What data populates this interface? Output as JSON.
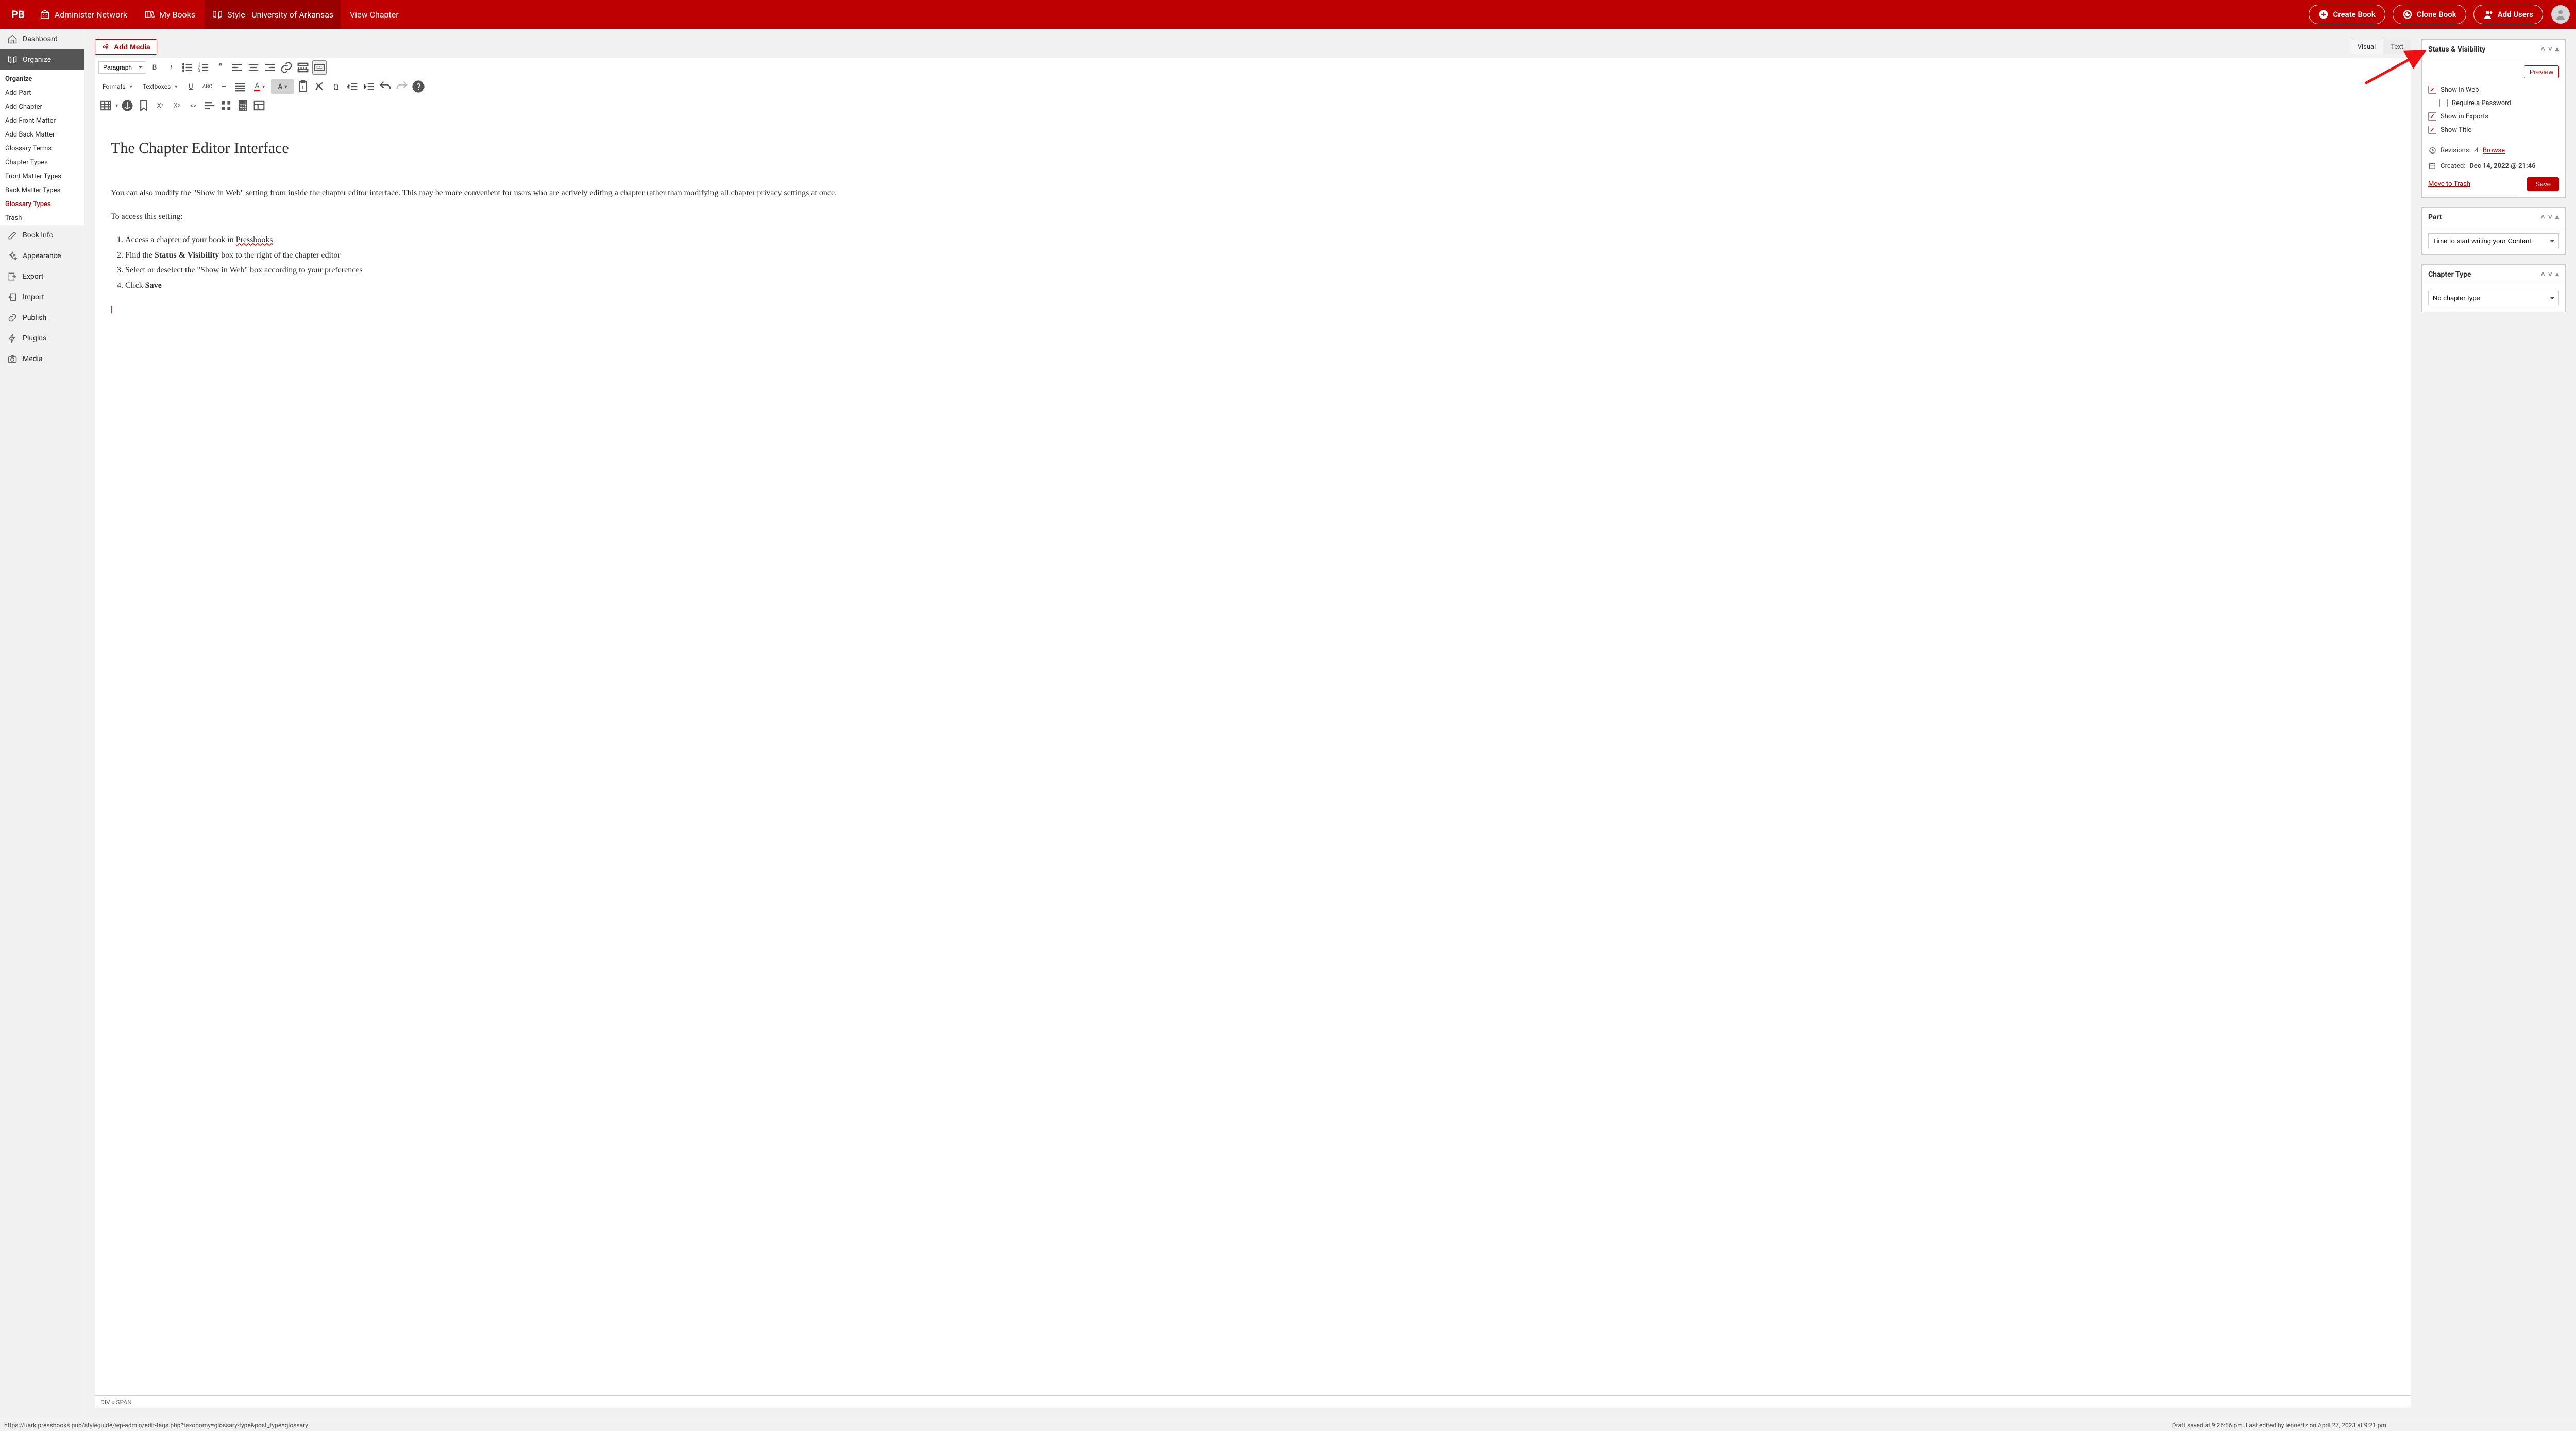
{
  "topbar": {
    "logo": "PB",
    "items": [
      {
        "label": "Administer Network",
        "icon": "building-icon"
      },
      {
        "label": "My Books",
        "icon": "books-icon"
      },
      {
        "label": "Style - University of Arkansas",
        "icon": "book-open-icon",
        "active": true
      },
      {
        "label": "View Chapter"
      }
    ],
    "buttons": [
      {
        "label": "Create Book",
        "icon": "plus-circle-icon"
      },
      {
        "label": "Clone Book",
        "icon": "clone-circle-icon"
      },
      {
        "label": "Add Users",
        "icon": "add-user-icon"
      }
    ]
  },
  "sidebar": {
    "top": [
      {
        "label": "Dashboard",
        "icon": "home-icon"
      },
      {
        "label": "Organize",
        "icon": "book-open-icon",
        "selected": true
      }
    ],
    "sub_header": "Organize",
    "sub": [
      "Add Part",
      "Add Chapter",
      "Add Front Matter",
      "Add Back Matter",
      "Glossary Terms",
      "Chapter Types",
      "Front Matter Types",
      "Back Matter Types",
      "Glossary Types",
      "Trash"
    ],
    "sub_current_index": 8,
    "bottom": [
      {
        "label": "Book Info",
        "icon": "edit-icon"
      },
      {
        "label": "Appearance",
        "icon": "sparkle-icon"
      },
      {
        "label": "Export",
        "icon": "export-icon"
      },
      {
        "label": "Import",
        "icon": "import-icon"
      },
      {
        "label": "Publish",
        "icon": "link-icon"
      },
      {
        "label": "Plugins",
        "icon": "bolt-icon"
      },
      {
        "label": "Media",
        "icon": "camera-icon"
      }
    ]
  },
  "editor": {
    "add_media": "Add Media",
    "tabs": {
      "visual": "Visual",
      "text": "Text",
      "active": "visual"
    },
    "format_select": "Paragraph",
    "dropdowns": {
      "formats": "Formats",
      "textboxes": "Textboxes"
    },
    "letter_a": "A",
    "hr_char": "—",
    "path": "DIV » SPAN",
    "doc": {
      "title": "The Chapter Editor Interface",
      "p1": "You can also modify the \"Show in Web\" setting from inside the chapter editor interface. This may be more convenient for users who are actively editing a chapter rather than modifying all chapter privacy settings at once.",
      "p2": "To access this setting:",
      "ol": [
        {
          "pre": "Access a chapter of your book in ",
          "wavy": "Pressbooks"
        },
        {
          "pre": "Find the ",
          "b": "Status & Visibility",
          "post": " box to the right of the chapter editor"
        },
        {
          "pre": "Select or deselect the \"Show in Web\" box according to your preferences"
        },
        {
          "pre": "Click ",
          "b": "Save"
        }
      ]
    }
  },
  "pane": {
    "status": {
      "title": "Status & Visibility",
      "preview": "Preview",
      "checks": [
        {
          "label": "Show in Web",
          "on": true
        },
        {
          "label": "Require a Password",
          "on": false,
          "indent": true
        },
        {
          "label": "Show in Exports",
          "on": true
        },
        {
          "label": "Show Title",
          "on": true
        }
      ],
      "revisions_label": "Revisions:",
      "revisions_count": "4",
      "browse": "Browse",
      "created_label": "Created:",
      "created_value": "Dec 14, 2022 @ 21:46",
      "trash": "Move to Trash",
      "save": "Save"
    },
    "part": {
      "title": "Part",
      "value": "Time to start writing your Content"
    },
    "chapter_type": {
      "title": "Chapter Type",
      "value": "No chapter type"
    }
  },
  "footer": {
    "left": "https://uark.pressbooks.pub/styleguide/wp-admin/edit-tags.php?taxonomy=glossary-type&post_type=glossary",
    "right": "Draft saved at 9:26:56 pm. Last edited by lennertz on April 27, 2023 at 9:21 pm"
  }
}
